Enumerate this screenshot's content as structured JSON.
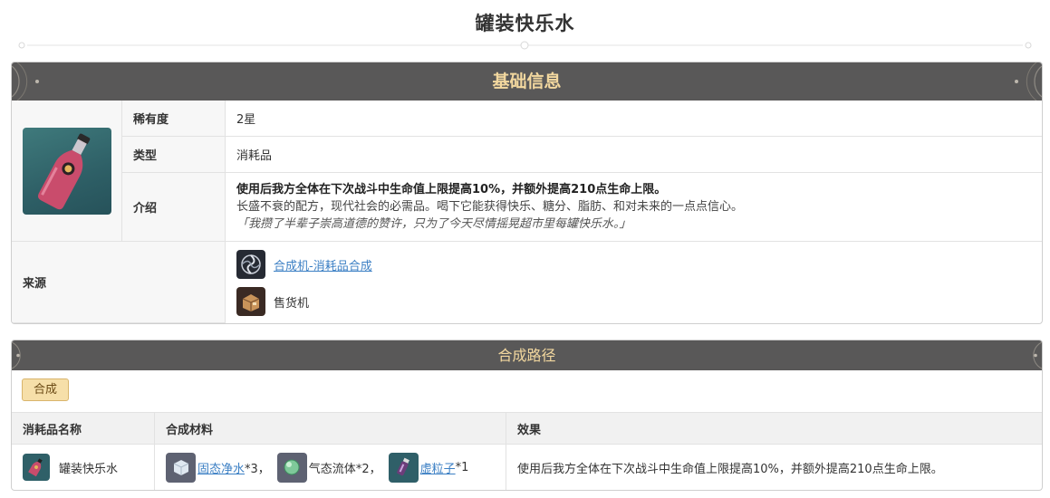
{
  "page": {
    "title": "罐装快乐水"
  },
  "basic_info": {
    "header": "基础信息",
    "rarity_label": "稀有度",
    "rarity_value": "2星",
    "type_label": "类型",
    "type_value": "消耗品",
    "intro_label": "介绍",
    "intro_effect": "使用后我方全体在下次战斗中生命值上限提高10%，并额外提高210点生命上限。",
    "intro_desc": "长盛不衰的配方，现代社会的必需品。喝下它能获得快乐、糖分、脂肪、和对未来的一点点信心。",
    "intro_quote": "「我攒了半辈子崇高道德的赞许，只为了今天尽情摇晃超市里每罐快乐水。」",
    "source_label": "来源",
    "sources": [
      {
        "label": "合成机-消耗品合成",
        "icon": "synthesizer-icon",
        "link": true
      },
      {
        "label": "售货机",
        "icon": "vending-machine-icon",
        "link": false
      }
    ]
  },
  "crafting": {
    "header": "合成路径",
    "tab": "合成",
    "columns": [
      "消耗品名称",
      "合成材料",
      "效果"
    ],
    "row": {
      "name": "罐装快乐水",
      "materials": [
        {
          "name": "固态净水",
          "qty": "*3，",
          "link": true,
          "icon": "ice-cube-icon"
        },
        {
          "name": "气态流体",
          "qty": "*2，",
          "link": false,
          "icon": "gas-orb-icon"
        },
        {
          "name": "虚粒子",
          "qty": "*1",
          "link": true,
          "icon": "particle-vial-icon"
        }
      ],
      "effect": "使用后我方全体在下次战斗中生命值上限提高10%，并额外提高210点生命上限。"
    }
  },
  "colors": {
    "header_bg": "#595858",
    "header_text": "#f3d89f",
    "link": "#3b7fc4",
    "tab_bg": "#f6dfa9"
  }
}
